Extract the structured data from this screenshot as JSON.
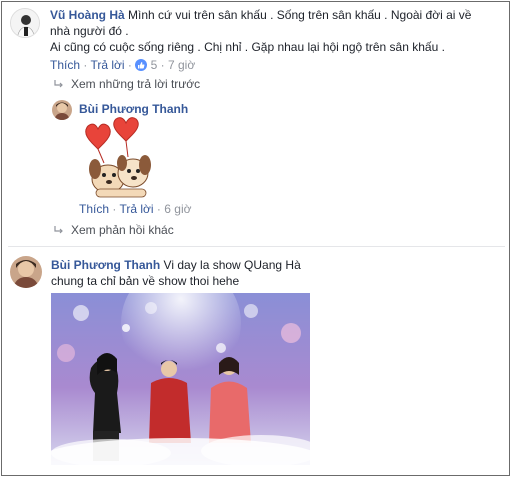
{
  "comment1": {
    "author": "Vũ Hoàng Hà",
    "text_line1": " Mình cứ vui trên sân khấu . Sống trên sân khấu . Ngoài đời ai về",
    "text_line2": "nhà người đó .",
    "text_line3": "Ai cũng có cuộc sống riêng . Chị nhỉ . Gặp nhau lại hội ngộ trên sân khấu .",
    "like_label": "Thích",
    "reply_label": "Trả lời",
    "reaction_count": "5",
    "time": "7 giờ",
    "dot": "·"
  },
  "previous_replies": {
    "label": "Xem những trả lời trước"
  },
  "reply1": {
    "author": "Bùi Phương Thanh",
    "sticker_name": "puppies-with-hearts-sticker",
    "like_label": "Thích",
    "reply_label": "Trả lời",
    "time": "6 giờ",
    "dot": "·"
  },
  "more_replies": {
    "label": "Xem phản hồi khác"
  },
  "comment2": {
    "author": "Bùi Phương Thanh",
    "text_line1": " Vi day la show QUang Hà",
    "text_line2": "chung ta chỉ bản về show thoi hehe"
  },
  "colors": {
    "name": "#365899",
    "text": "#1d2129",
    "meta": "#90949c",
    "stage_bg": "#7f8fd0"
  }
}
